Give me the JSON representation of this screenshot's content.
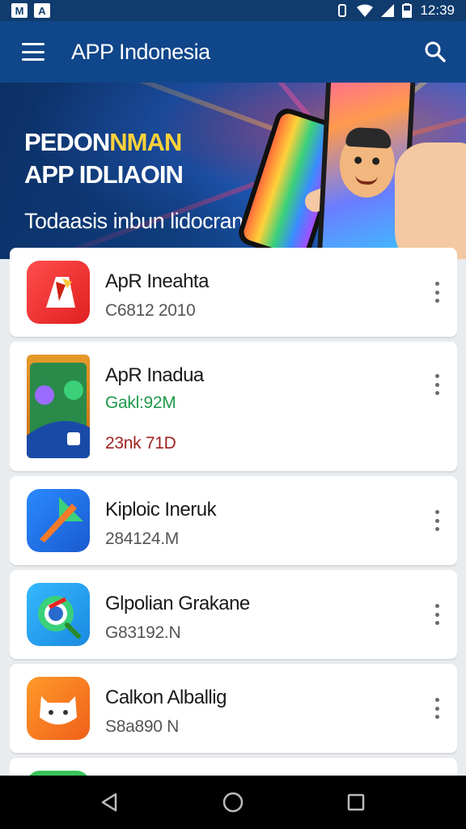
{
  "status_bar": {
    "time": "12:39",
    "left_icons": [
      "M",
      "A"
    ],
    "right_icons": [
      "vibrate-icon",
      "wifi-icon",
      "signal-icon",
      "battery-icon"
    ]
  },
  "app_bar": {
    "title": "APP Indonesia",
    "menu_icon": "hamburger-menu-icon",
    "search_icon": "search-icon",
    "background": "#10468a"
  },
  "banner": {
    "heading_line1_a": "PEDON",
    "heading_line1_b": "NMAN",
    "heading_line2": "APP IDLIAOIN",
    "subtitle": "Todaasis inbun lidocran"
  },
  "apps": [
    {
      "name": "ApR Ineahta",
      "meta": "C6812 2010"
    },
    {
      "name": "ApR Inadua",
      "meta": "Gakl:92M",
      "meta2": "23nk 71D"
    },
    {
      "name": "Kiploic Ineruk",
      "meta": "284124.M"
    },
    {
      "name": "Glpolian Grakane",
      "meta": "G83192.N"
    },
    {
      "name": "Calkon Alballig",
      "meta": "S8a890 N"
    }
  ],
  "nav_bar": {
    "back_icon": "back-triangle-icon",
    "home_icon": "home-circle-icon",
    "recents_icon": "recents-square-icon"
  }
}
